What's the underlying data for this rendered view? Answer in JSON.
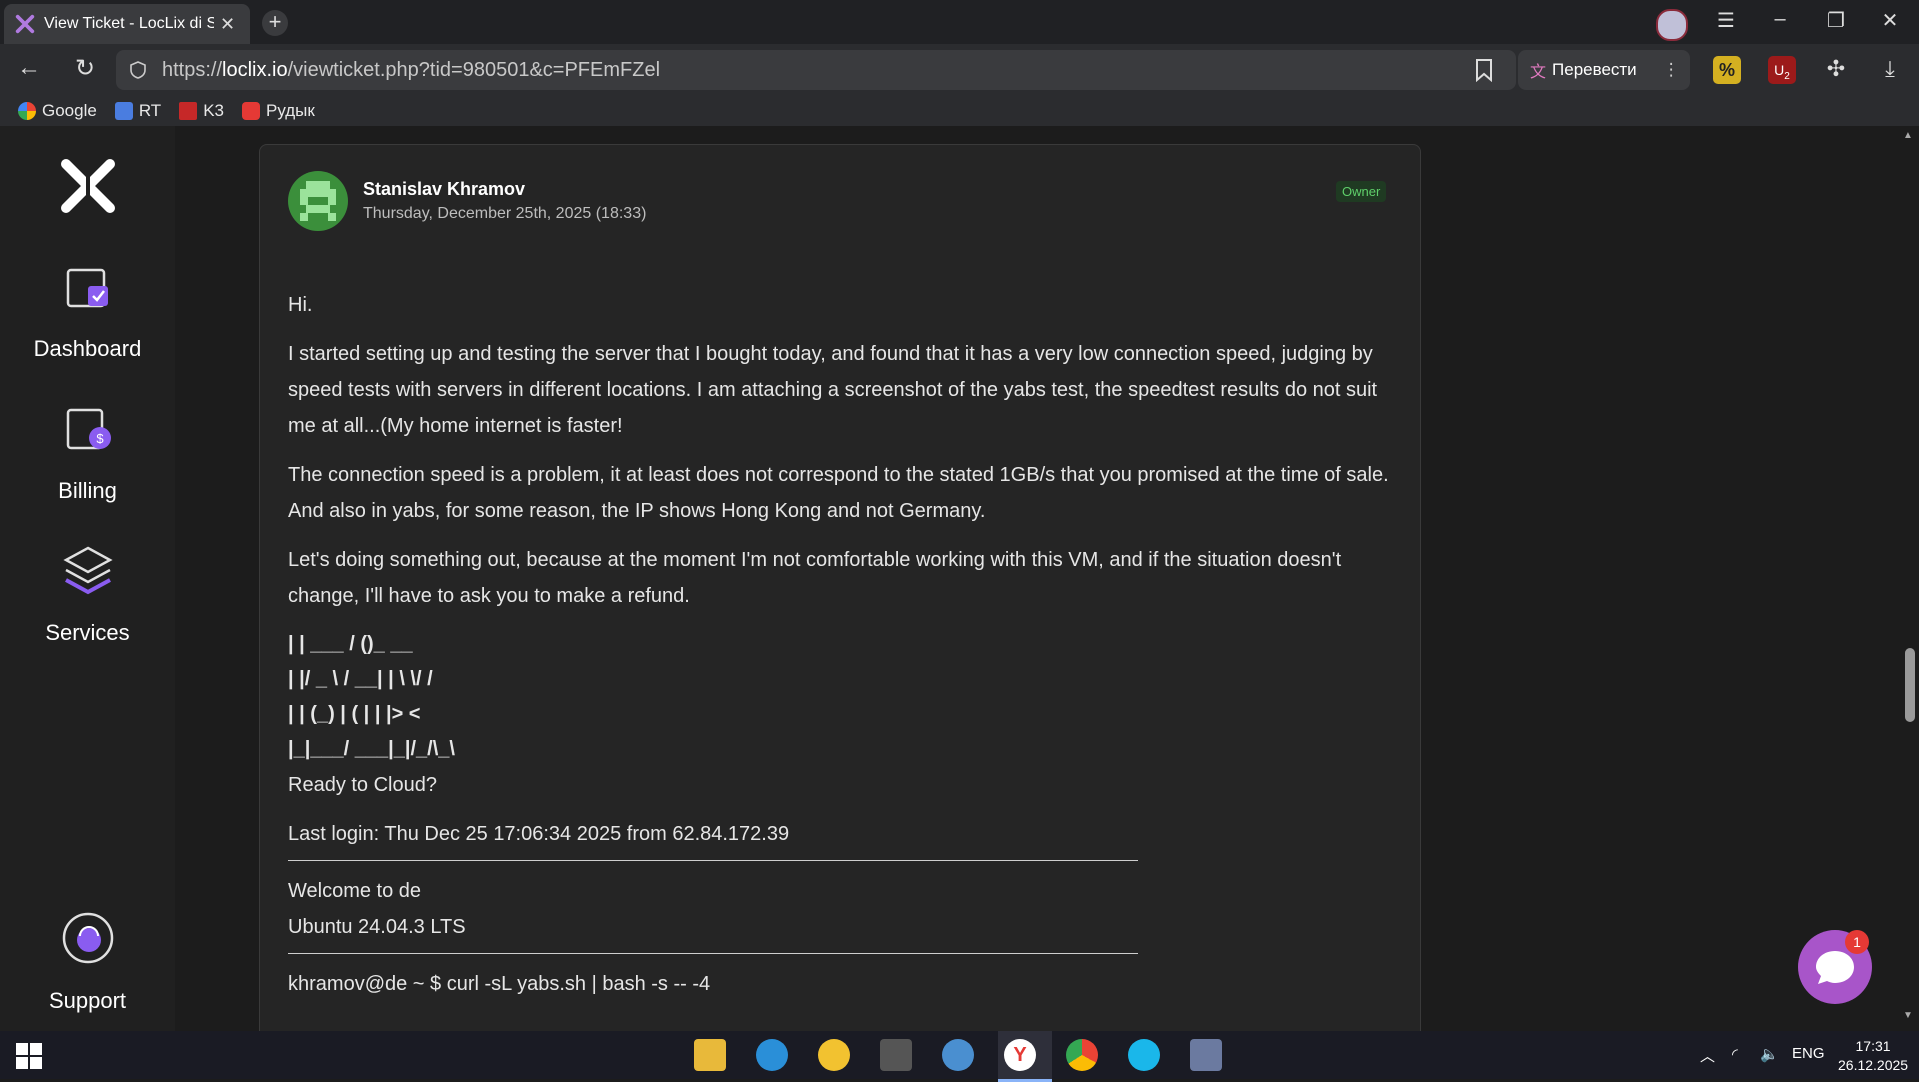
{
  "browser": {
    "tab_title": "View Ticket - LocLix di S",
    "tab_close": "✕",
    "new_tab": "+",
    "url_prefix": "https://",
    "url_domain": "loclix.io",
    "url_path": "/viewticket.php?tid=980501&c=PFEmFZel",
    "translate_label": "Перевести",
    "bookmarks": [
      "Google",
      "RT",
      "K3",
      "Рудык"
    ],
    "extension_badge": "2"
  },
  "sidebar": {
    "items": [
      {
        "label": "Dashboard",
        "icon": "dashboard-icon"
      },
      {
        "label": "Billing",
        "icon": "billing-icon"
      },
      {
        "label": "Services",
        "icon": "services-icon"
      },
      {
        "label": "Support",
        "icon": "support-icon"
      }
    ]
  },
  "reply": {
    "author": "Stanislav Khramov",
    "date": "Thursday, December 25th, 2025 (18:33)",
    "role_badge": "Owner",
    "paragraphs": [
      "Hi.",
      "I started setting up and testing the server that I bought today, and found that it has a very low connection speed, judging by speed tests with servers in different locations. I am attaching a screenshot of the yabs test, the speedtest results do not suit me at all...(My home internet is faster!",
      "The connection speed is a problem, it at least does not correspond to the stated 1GB/s that you promised at the time of sale. And also in yabs, for some reason, the IP shows Hong Kong and not Germany.",
      "Let's doing something out, because at the moment I'm not comfortable working with this VM, and if the situation doesn't change, I'll have to ask you to make a refund."
    ],
    "ascii_lines": [
      "| | ___ / ()_ __",
      "| |/ _ \\ / __| | \\ \\/ /",
      "| | (_) | ( | | |> <",
      "|_|___/ ___|_|/_/\\_\\"
    ],
    "ready_line": "Ready to Cloud?",
    "last_login": "Last login: Thu Dec 25 17:06:34 2025 from 62.84.172.39",
    "welcome": "Welcome to de",
    "os": "Ubuntu 24.04.3 LTS",
    "command": "khramov@de ~ $ curl -sL yabs.sh | bash -s -- -4"
  },
  "chat_widget": {
    "badge": "1"
  },
  "taskbar": {
    "language": "ENG",
    "time": "17:31",
    "date": "26.12.2025"
  },
  "colors": {
    "accent_purple": "#a855c9",
    "owner_green": "#5fcf6a"
  }
}
